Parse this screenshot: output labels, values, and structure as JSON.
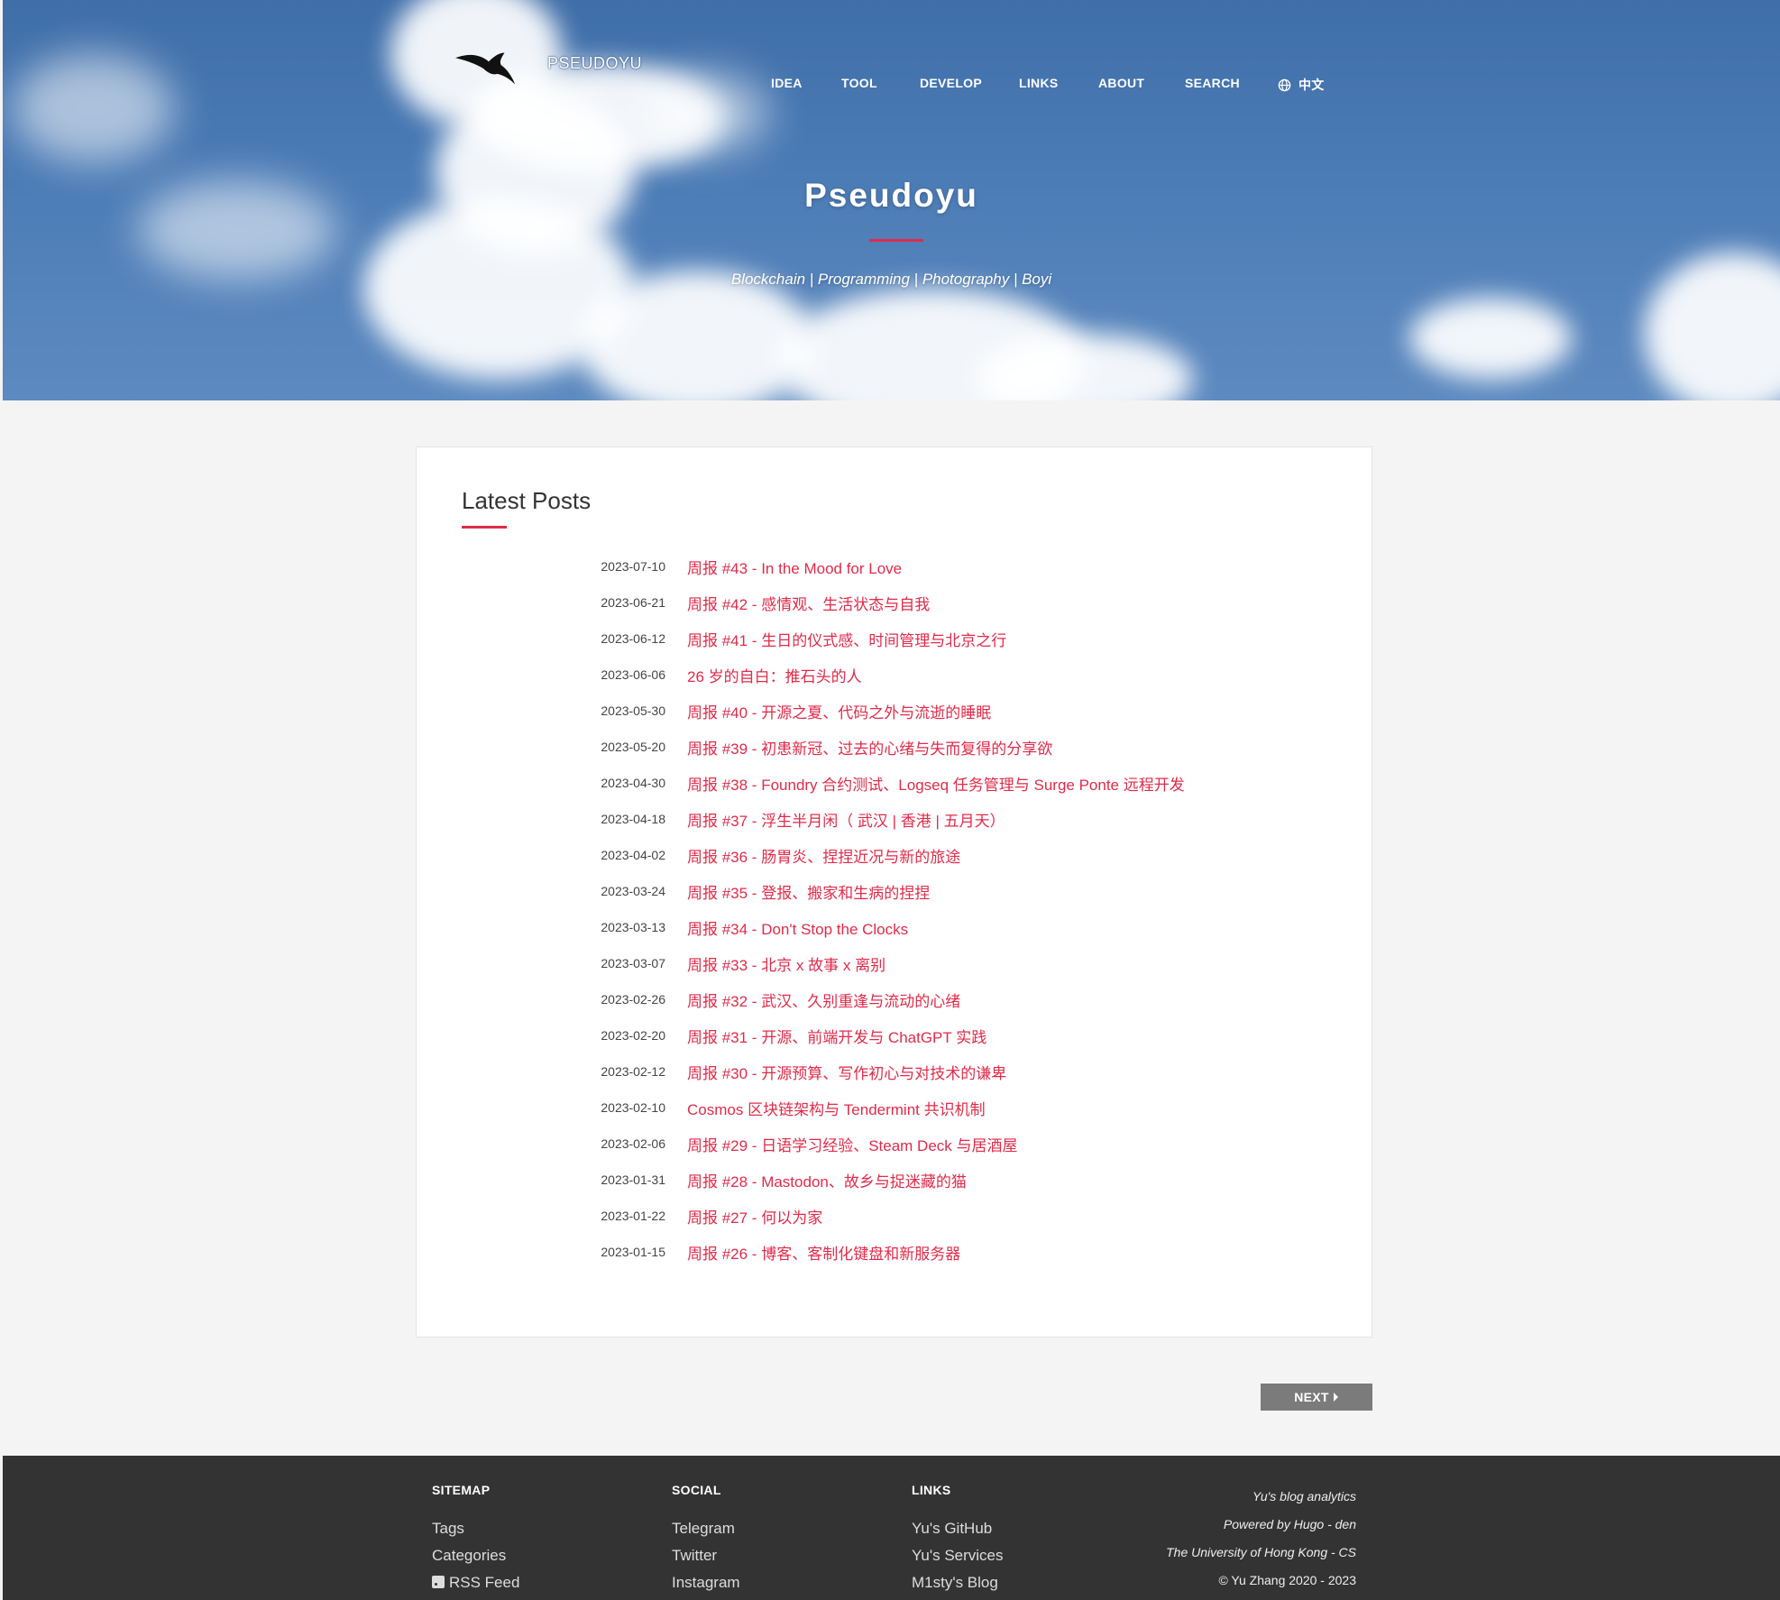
{
  "site": {
    "brand": "PSEUDOYU"
  },
  "nav": {
    "items": [
      "IDEA",
      "TOOL",
      "DEVELOP",
      "LINKS",
      "ABOUT",
      "SEARCH"
    ],
    "language": "中文"
  },
  "hero": {
    "title": "Pseudoyu",
    "subtitle": "Blockchain | Programming | Photography | Boyi"
  },
  "posts": {
    "heading": "Latest Posts",
    "items": [
      {
        "date": "2023-07-10",
        "title": "周报 #43 - In the Mood for Love"
      },
      {
        "date": "2023-06-21",
        "title": "周报 #42 - 感情观、生活状态与自我"
      },
      {
        "date": "2023-06-12",
        "title": "周报 #41 - 生日的仪式感、时间管理与北京之行"
      },
      {
        "date": "2023-06-06",
        "title": "26 岁的自白：推石头的人"
      },
      {
        "date": "2023-05-30",
        "title": "周报 #40 - 开源之夏、代码之外与流逝的睡眠"
      },
      {
        "date": "2023-05-20",
        "title": "周报 #39 - 初患新冠、过去的心绪与失而复得的分享欲"
      },
      {
        "date": "2023-04-30",
        "title": "周报 #38 - Foundry 合约测试、Logseq 任务管理与 Surge Ponte 远程开发"
      },
      {
        "date": "2023-04-18",
        "title": "周报 #37 - 浮生半月闲（ 武汉 | 香港 | 五月天）"
      },
      {
        "date": "2023-04-02",
        "title": "周报 #36 - 肠胃炎、捏捏近况与新的旅途"
      },
      {
        "date": "2023-03-24",
        "title": "周报 #35 - 登报、搬家和生病的捏捏"
      },
      {
        "date": "2023-03-13",
        "title": "周报 #34 - Don't Stop the Clocks"
      },
      {
        "date": "2023-03-07",
        "title": "周报 #33 - 北京 x 故事 x 离别"
      },
      {
        "date": "2023-02-26",
        "title": "周报 #32 - 武汉、久别重逢与流动的心绪"
      },
      {
        "date": "2023-02-20",
        "title": "周报 #31 - 开源、前端开发与 ChatGPT 实践"
      },
      {
        "date": "2023-02-12",
        "title": "周报 #30 - 开源预算、写作初心与对技术的谦卑"
      },
      {
        "date": "2023-02-10",
        "title": "Cosmos 区块链架构与 Tendermint 共识机制"
      },
      {
        "date": "2023-02-06",
        "title": "周报 #29 - 日语学习经验、Steam Deck 与居酒屋"
      },
      {
        "date": "2023-01-31",
        "title": "周报 #28 - Mastodon、故乡与捉迷藏的猫"
      },
      {
        "date": "2023-01-22",
        "title": "周报 #27 - 何以为家"
      },
      {
        "date": "2023-01-15",
        "title": "周报 #26 - 博客、客制化键盘和新服务器"
      }
    ]
  },
  "pagination": {
    "next_label": "NEXT"
  },
  "footer": {
    "sitemap": {
      "heading": "SITEMAP",
      "links": [
        "Tags",
        "Categories",
        "RSS Feed"
      ]
    },
    "social": {
      "heading": "SOCIAL",
      "links": [
        "Telegram",
        "Twitter",
        "Instagram"
      ]
    },
    "links": {
      "heading": "LINKS",
      "links": [
        "Yu's GitHub",
        "Yu's Services",
        "M1sty's Blog"
      ]
    },
    "info": [
      "Yu's blog analytics",
      "Powered by Hugo - den",
      "The University of Hong Kong - CS",
      "© Yu Zhang 2020 - 2023"
    ]
  },
  "colors": {
    "accent": "#e02b4a",
    "footer_bg": "#333333",
    "page_bg": "#f4f4f4",
    "sky": "#4c7cb6"
  }
}
